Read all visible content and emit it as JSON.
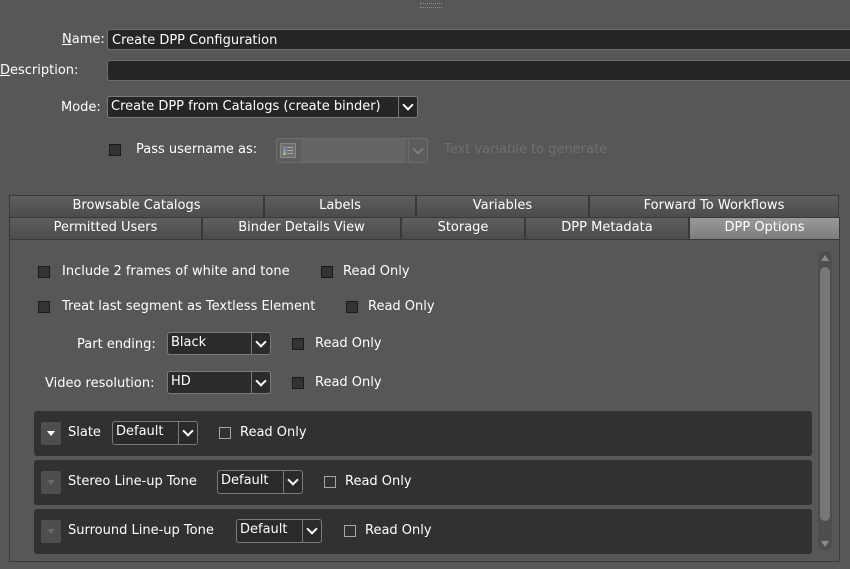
{
  "form": {
    "name_label": "Name:",
    "name_value": "Create DPP Configuration",
    "description_label": "Description:",
    "description_value": "",
    "mode_label": "Mode:",
    "mode_value": "Create DPP from Catalogs (create binder)",
    "pass_username_label": "Pass username as:",
    "pass_username_checked": false,
    "pass_username_value": "",
    "text_variable_hint": "Text variable to generate"
  },
  "tabs_top": [
    "Browsable Catalogs",
    "Labels",
    "Variables",
    "Forward To Workflows"
  ],
  "tabs_bottom": [
    "Permitted Users",
    "Binder Details View",
    "Storage",
    "DPP Metadata",
    "DPP Options"
  ],
  "active_tab": "DPP Options",
  "options": {
    "include_frames_label": "Include 2 frames of white and tone",
    "treat_last_label": "Treat last segment as Textless Element",
    "read_only_label": "Read Only",
    "part_ending_label": "Part ending:",
    "part_ending_value": "Black",
    "video_resolution_label": "Video resolution:",
    "video_resolution_value": "HD"
  },
  "sections": [
    {
      "label": "Slate",
      "value": "Default",
      "read_only": "Read Only"
    },
    {
      "label": "Stereo Line-up Tone",
      "value": "Default",
      "read_only": "Read Only"
    },
    {
      "label": "Surround Line-up Tone",
      "value": "Default",
      "read_only": "Read Only"
    }
  ],
  "colors": {
    "background": "#575757",
    "field": "#252525",
    "active_tab": "#8a8a8a",
    "section": "#313131"
  }
}
